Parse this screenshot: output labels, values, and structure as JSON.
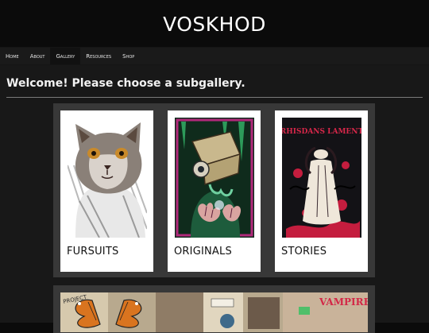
{
  "site": {
    "title": "VOSKHOD"
  },
  "nav": {
    "items": [
      {
        "label": "Home"
      },
      {
        "label": "About"
      },
      {
        "label": "Gallery"
      },
      {
        "label": "Resources"
      },
      {
        "label": "Shop"
      }
    ],
    "active": "Gallery"
  },
  "main": {
    "welcome": "Welcome! Please choose a subgallery."
  },
  "gallery": {
    "cards": [
      {
        "label": "FURSUITS"
      },
      {
        "label": "ORIGINALS"
      },
      {
        "label": "STORIES"
      }
    ]
  },
  "banner": {
    "texts": [
      "PROJECT",
      "VAMPIRE"
    ]
  },
  "stories_art_text": "RHISDANS LAMENT"
}
